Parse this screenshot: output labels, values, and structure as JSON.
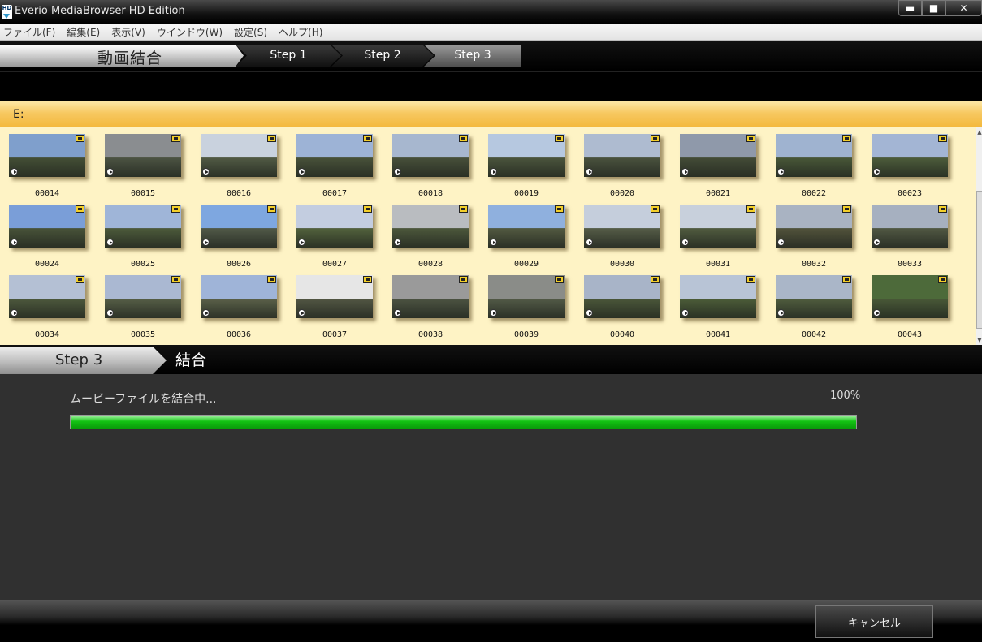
{
  "window": {
    "title": "Everio MediaBrowser HD Edition",
    "icon_label": "HD"
  },
  "menu": [
    "ファイル(F)",
    "編集(E)",
    "表示(V)",
    "ウインドウ(W)",
    "設定(S)",
    "ヘルプ(H)"
  ],
  "steps": {
    "title": "動画結合",
    "step1": "Step 1",
    "step2": "Step 2",
    "step3": "Step 3",
    "active": "Step 3"
  },
  "path": "E:",
  "clips": [
    {
      "name": "00014",
      "sky": "#7f9fcc",
      "ground": "#3f4d33"
    },
    {
      "name": "00015",
      "sky": "#8a8d90",
      "ground": "#5a5c5e"
    },
    {
      "name": "00016",
      "sky": "#c9d2de",
      "ground": "#6d7464"
    },
    {
      "name": "00017",
      "sky": "#9db3d6",
      "ground": "#4e5740"
    },
    {
      "name": "00018",
      "sky": "#a7b7cf",
      "ground": "#4c5142"
    },
    {
      "name": "00019",
      "sky": "#b6c8e0",
      "ground": "#566049"
    },
    {
      "name": "00020",
      "sky": "#aebbd0",
      "ground": "#54584d"
    },
    {
      "name": "00021",
      "sky": "#8f99aa",
      "ground": "#3e4236"
    },
    {
      "name": "00022",
      "sky": "#9fb3d0",
      "ground": "#4f6a3a"
    },
    {
      "name": "00023",
      "sky": "#a3b5d4",
      "ground": "#5d7a44"
    },
    {
      "name": "00024",
      "sky": "#7a9ed8",
      "ground": "#4d5a3d"
    },
    {
      "name": "00025",
      "sky": "#9fb5d8",
      "ground": "#5b7343"
    },
    {
      "name": "00026",
      "sky": "#7ea7e0",
      "ground": "#6b6f70"
    },
    {
      "name": "00027",
      "sky": "#c3cde0",
      "ground": "#6f8c4b"
    },
    {
      "name": "00028",
      "sky": "#b9bcc0",
      "ground": "#5c6a47"
    },
    {
      "name": "00029",
      "sky": "#8fb0de",
      "ground": "#707058"
    },
    {
      "name": "00030",
      "sky": "#c5cedc",
      "ground": "#7a7a6e"
    },
    {
      "name": "00031",
      "sky": "#c8d0dc",
      "ground": "#6a7653"
    },
    {
      "name": "00032",
      "sky": "#a9b3c2",
      "ground": "#6e5a46"
    },
    {
      "name": "00033",
      "sky": "#a6b0c0",
      "ground": "#6a6a5e"
    },
    {
      "name": "00034",
      "sky": "#b4c0d4",
      "ground": "#5d6b48"
    },
    {
      "name": "00035",
      "sky": "#aab8d2",
      "ground": "#7a7e6a"
    },
    {
      "name": "00036",
      "sky": "#9fb4d8",
      "ground": "#8a8672"
    },
    {
      "name": "00037",
      "sky": "#e6e6e6",
      "ground": "#6e6560"
    },
    {
      "name": "00038",
      "sky": "#9a9a9a",
      "ground": "#5a5a5a"
    },
    {
      "name": "00039",
      "sky": "#8a8c88",
      "ground": "#6e706a"
    },
    {
      "name": "00040",
      "sky": "#a8b4c8",
      "ground": "#55663f"
    },
    {
      "name": "00041",
      "sky": "#b8c4d6",
      "ground": "#5a7a3c"
    },
    {
      "name": "00042",
      "sky": "#aab6c8",
      "ground": "#667a4e"
    },
    {
      "name": "00043",
      "sky": "#4d6a3a",
      "ground": "#4f6d38"
    }
  ],
  "step3bar": {
    "step": "Step 3",
    "label": "結合"
  },
  "progress": {
    "status": "ムービーファイルを結合中...",
    "percent_text": "100%",
    "value": 1.0
  },
  "cancel_label": "キャンセル",
  "colors": {
    "progress": "#13c313",
    "path_bar": "#f7c860",
    "grid_bg": "#fef3c5"
  }
}
